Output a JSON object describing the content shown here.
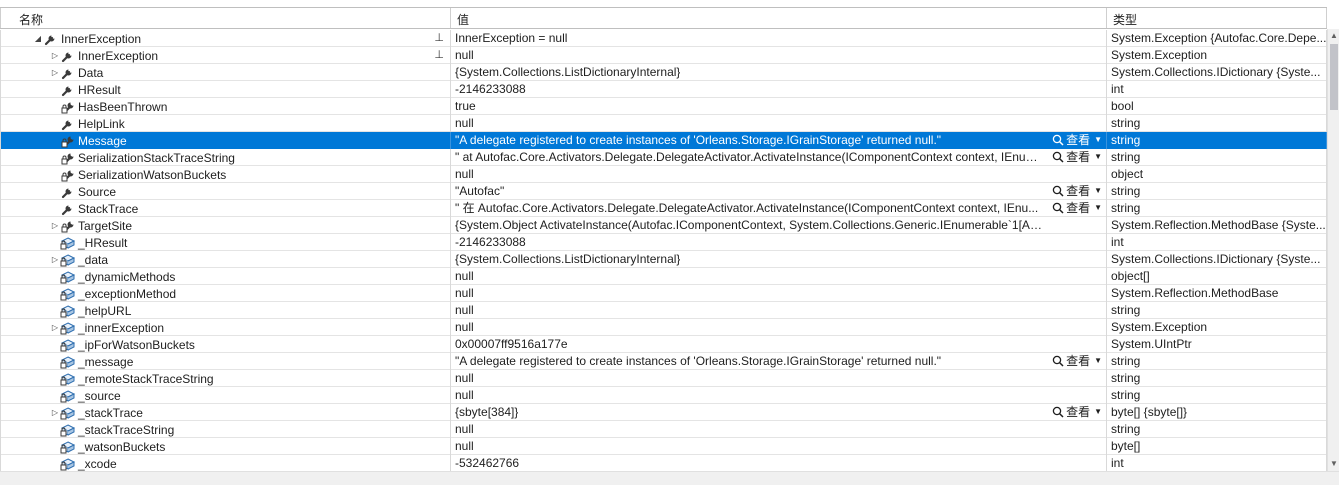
{
  "header": {
    "name": "名称",
    "value": "值",
    "type": "类型"
  },
  "view_label": "查看",
  "rows": [
    {
      "name": "InnerException",
      "value": "InnerException = null",
      "type": "System.Exception {Autofac.Core.Depe...",
      "level": 0,
      "expand": "open",
      "icon": "wrench",
      "pin": true
    },
    {
      "name": "InnerException",
      "value": "null",
      "type": "System.Exception",
      "level": 1,
      "expand": "closed",
      "icon": "wrench",
      "pin": true
    },
    {
      "name": "Data",
      "value": "{System.Collections.ListDictionaryInternal}",
      "type": "System.Collections.IDictionary {Syste...",
      "level": 1,
      "expand": "closed",
      "icon": "wrench"
    },
    {
      "name": "HResult",
      "value": "-2146233088",
      "type": "int",
      "level": 1,
      "icon": "wrench"
    },
    {
      "name": "HasBeenThrown",
      "value": "true",
      "type": "bool",
      "level": 1,
      "icon": "wrench-lock"
    },
    {
      "name": "HelpLink",
      "value": "null",
      "type": "string",
      "level": 1,
      "icon": "wrench"
    },
    {
      "name": "Message",
      "value": "\"A delegate registered to create instances of 'Orleans.Storage.IGrainStorage' returned null.\"",
      "type": "string",
      "level": 1,
      "icon": "wrench-lock",
      "view": true,
      "selected": true
    },
    {
      "name": "SerializationStackTraceString",
      "value": "\"   at Autofac.Core.Activators.Delegate.DelegateActivator.ActivateInstance(IComponentContext context, IEnum...",
      "type": "string",
      "level": 1,
      "icon": "wrench-lock",
      "view": true
    },
    {
      "name": "SerializationWatsonBuckets",
      "value": "null",
      "type": "object",
      "level": 1,
      "icon": "wrench-lock"
    },
    {
      "name": "Source",
      "value": "\"Autofac\"",
      "type": "string",
      "level": 1,
      "icon": "wrench",
      "view": true
    },
    {
      "name": "StackTrace",
      "value": "\"   在 Autofac.Core.Activators.Delegate.DelegateActivator.ActivateInstance(IComponentContext context, IEnu...",
      "type": "string",
      "level": 1,
      "icon": "wrench",
      "view": true
    },
    {
      "name": "TargetSite",
      "value": "{System.Object ActivateInstance(Autofac.IComponentContext, System.Collections.Generic.IEnumerable`1[Autofac.Core.P...",
      "type": "System.Reflection.MethodBase {Syste...",
      "level": 1,
      "expand": "closed",
      "icon": "wrench-lock"
    },
    {
      "name": "_HResult",
      "value": "-2146233088",
      "type": "int",
      "level": 1,
      "icon": "field"
    },
    {
      "name": "_data",
      "value": "{System.Collections.ListDictionaryInternal}",
      "type": "System.Collections.IDictionary {Syste...",
      "level": 1,
      "expand": "closed",
      "icon": "field"
    },
    {
      "name": "_dynamicMethods",
      "value": "null",
      "type": "object[]",
      "level": 1,
      "icon": "field"
    },
    {
      "name": "_exceptionMethod",
      "value": "null",
      "type": "System.Reflection.MethodBase",
      "level": 1,
      "icon": "field"
    },
    {
      "name": "_helpURL",
      "value": "null",
      "type": "string",
      "level": 1,
      "icon": "field"
    },
    {
      "name": "_innerException",
      "value": "null",
      "type": "System.Exception",
      "level": 1,
      "expand": "closed",
      "icon": "field"
    },
    {
      "name": "_ipForWatsonBuckets",
      "value": "0x00007ff9516a177e",
      "type": "System.UIntPtr",
      "level": 1,
      "icon": "field"
    },
    {
      "name": "_message",
      "value": "\"A delegate registered to create instances of 'Orleans.Storage.IGrainStorage' returned null.\"",
      "type": "string",
      "level": 1,
      "icon": "field",
      "view": true
    },
    {
      "name": "_remoteStackTraceString",
      "value": "null",
      "type": "string",
      "level": 1,
      "icon": "field"
    },
    {
      "name": "_source",
      "value": "null",
      "type": "string",
      "level": 1,
      "icon": "field"
    },
    {
      "name": "_stackTrace",
      "value": "{sbyte[384]}",
      "type": "byte[] {sbyte[]}",
      "level": 1,
      "expand": "closed",
      "icon": "field",
      "view": true
    },
    {
      "name": "_stackTraceString",
      "value": "null",
      "type": "string",
      "level": 1,
      "icon": "field"
    },
    {
      "name": "_watsonBuckets",
      "value": "null",
      "type": "byte[]",
      "level": 1,
      "icon": "field"
    },
    {
      "name": "_xcode",
      "value": "-532462766",
      "type": "int",
      "level": 1,
      "icon": "field"
    }
  ]
}
